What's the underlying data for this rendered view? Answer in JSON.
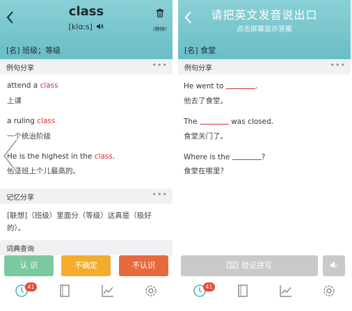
{
  "left_screen": {
    "header": {
      "word": "class",
      "phonetic": "[klɑːs]",
      "trash_label": "(移除)",
      "definition": "[名] 班级；等级"
    },
    "example_section": {
      "title": "例句分享",
      "more": "•••",
      "examples": [
        {
          "en_before": "attend a ",
          "en_highlight": "class",
          "en_after": "",
          "zh": "上课"
        },
        {
          "en_before": "a ruling ",
          "en_highlight": "class",
          "en_after": "",
          "zh": "一个统治阶级"
        },
        {
          "en_before": "He is the highest in the ",
          "en_highlight": "class",
          "en_after": ".",
          "zh": "他是班上个儿最高的。"
        }
      ]
    },
    "memory_section": {
      "title": "记忆分享",
      "more": "•••",
      "text": "[联想]（班级）里面分（等级）这真是（极好的）。"
    },
    "dict_section": {
      "title": "词典查询"
    },
    "buttons": {
      "know": "认 识",
      "unsure": "不确定",
      "unknown": "不认识"
    },
    "tabs": [
      {
        "label": "",
        "badge": "41"
      },
      {
        "label": ""
      },
      {
        "label": ""
      },
      {
        "label": ""
      }
    ]
  },
  "right_screen": {
    "header": {
      "prompt": "请把英文发音说出口",
      "hint": "点击屏幕显示答案",
      "definition": "[名] 食堂"
    },
    "example_section": {
      "title": "例句分享",
      "more": "•••",
      "examples": [
        {
          "en_before": "He went to ",
          "en_after": ".",
          "zh": "他去了食堂。"
        },
        {
          "en_before": "The ",
          "en_after": " was closed.",
          "zh": "食堂关门了。"
        },
        {
          "en_before": "Where is the ",
          "en_after": "?",
          "zh": "食堂在哪里?"
        }
      ]
    },
    "buttons": {
      "verify": "验证拼写"
    },
    "tabs": [
      {
        "label": "",
        "badge": "41"
      },
      {
        "label": ""
      },
      {
        "label": ""
      },
      {
        "label": ""
      }
    ]
  },
  "colors": {
    "header_teal": "#7cc7cf",
    "highlight_red": "#d0332f",
    "know_green": "#7bc9a0",
    "unsure_orange": "#f3ac2b",
    "unknown_red": "#e76a3f",
    "disabled_gray": "#c9c9cc",
    "badge_red": "#e34b3a"
  },
  "icons": [
    "back-icon",
    "speaker-icon",
    "trash-icon",
    "more-icon",
    "swipe-arrow-icon",
    "keyboard-icon",
    "sound-icon",
    "review-clock-icon",
    "wordbook-icon",
    "stats-chart-icon",
    "settings-gear-icon"
  ]
}
